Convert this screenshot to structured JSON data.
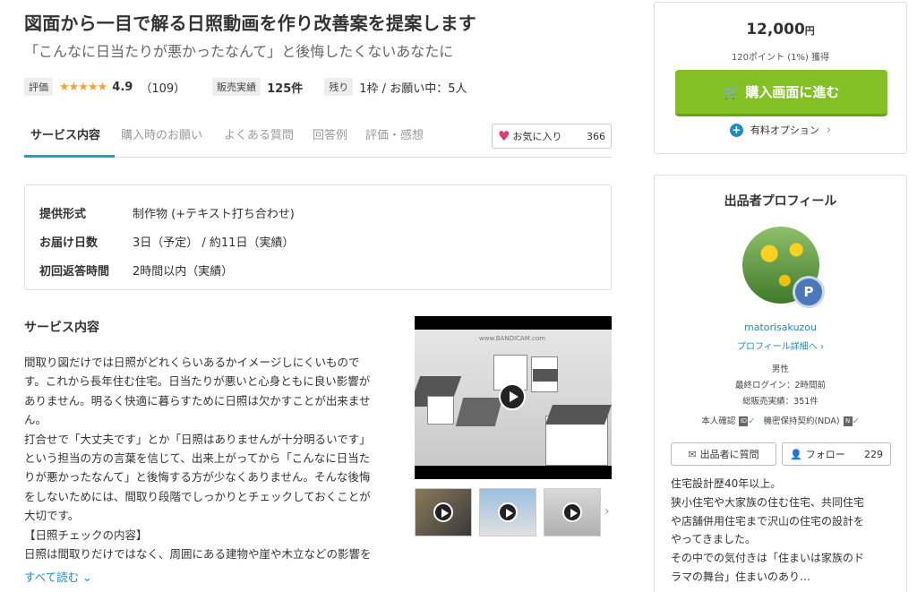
{
  "header": {
    "title": "図面から一目で解る日照動画を作り改善案を提案します",
    "subtitle": "「こんなに日当たりが悪かったなんて」と後悔したくないあなたに"
  },
  "stats": {
    "rating_tag": "評価",
    "stars": "★★★★★",
    "rating": "4.9",
    "review_count": "（109）",
    "sales_tag": "販売実績",
    "sales_value": "125件",
    "remain_tag": "残り",
    "remain_value": "1枠 / お願い中：5人"
  },
  "tabs": [
    {
      "label": "サービス内容",
      "active": true
    },
    {
      "label": "購入時のお願い"
    },
    {
      "label": "よくある質問"
    },
    {
      "label": "回答例"
    },
    {
      "label": "評価・感想"
    }
  ],
  "favorite": {
    "label": "お気に入り",
    "count": "366"
  },
  "info": [
    {
      "label": "提供形式",
      "value": "制作物 (+テキスト打ち合わせ)"
    },
    {
      "label": "お届け日数",
      "value": "3日（予定） / 約11日（実績）"
    },
    {
      "label": "初回返答時間",
      "value": "2時間以内（実績）"
    }
  ],
  "description": {
    "title": "サービス内容",
    "lines": [
      "間取り図だけでは日照がどれくらいあるかイメージしにくいもので",
      "す。これから長年住む住宅。日当たりが悪いと心身ともに良い影響が",
      "ありません。明るく快適に暮らすために日照は欠かすことが出来ませ",
      "ん。",
      "打合せで「大丈夫です」とか「日照はありませんが十分明るいです」",
      "という担当の方の言葉を信じて、出来上がってから「こんなに日当た",
      "りが悪かったなんて」と後悔する方が少なくありません。そんな後悔",
      "をしないためには、間取り段階でしっかりとチェックしておくことが",
      "大切です。",
      "【日照チェックの内容】",
      "日照は間取りだけではなく、周囲にある建物や崖や木立などの影響を"
    ],
    "read_all": "すべて読む"
  },
  "video": {
    "watermark": "www.BANDICAM.com"
  },
  "price": {
    "amount": "12,000",
    "unit": "円",
    "points": "120ポイント (1%) 獲得",
    "buy_label": "購入画面に進む",
    "options_label": "有料オプション"
  },
  "profile": {
    "title": "出品者プロフィール",
    "badge": "P",
    "username": "matorisakuzou",
    "detail_link": "プロフィール詳細へ",
    "gender": "男性",
    "last_login": "最終ログイン：2時間前",
    "total_sales": "総販売実績：351件",
    "identity": "本人確認",
    "nda": "機密保持契約(NDA)",
    "message_label": "出品者に質問",
    "follow_label": "フォロー",
    "follow_count": "229",
    "bio": [
      "住宅設計歴40年以上。",
      "狭小住宅や大家族の住む住宅、共同住宅",
      "や店舗併用住宅まで沢山の住宅の設計を",
      "やってきました。",
      "その中での気付きは「住まいは家族のド",
      "ラマの舞台」住まいのあり…"
    ]
  },
  "colors": {
    "accent": "#20a0c8",
    "buy": "#82c024",
    "link": "#1a8cc8",
    "star": "#f5a623",
    "heart": "#e8337f"
  }
}
